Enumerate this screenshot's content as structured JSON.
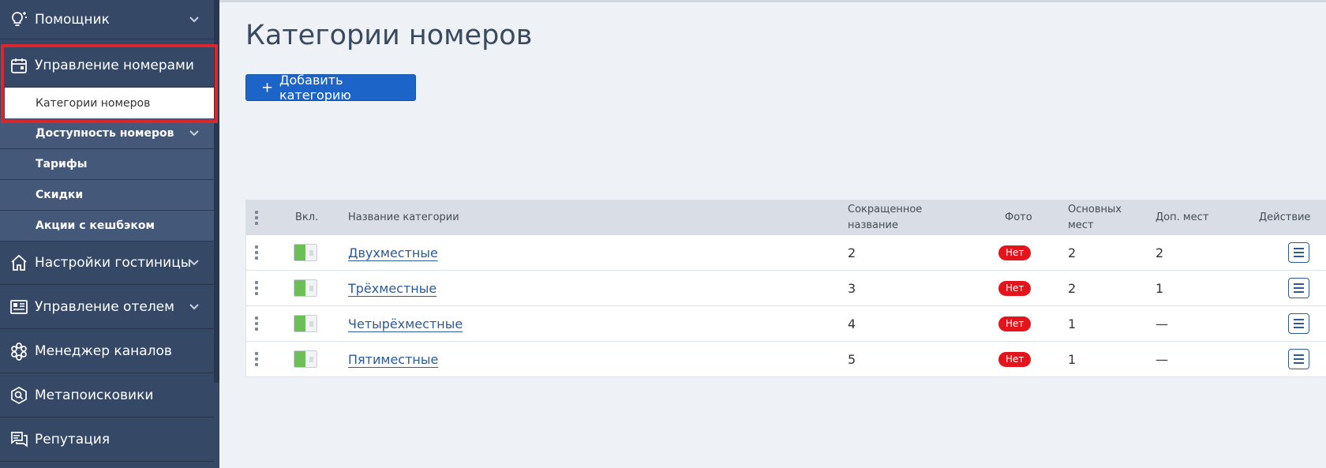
{
  "sidebar": {
    "items": [
      {
        "label": "Помощник"
      },
      {
        "label": "Управление номерами"
      },
      {
        "label": "Настройки гостиницы"
      },
      {
        "label": "Управление отелем"
      },
      {
        "label": "Менеджер каналов"
      },
      {
        "label": "Метапоисковики"
      },
      {
        "label": "Репутация"
      }
    ],
    "subitems": [
      {
        "label": "Категории номеров"
      },
      {
        "label": "Доступность номеров"
      },
      {
        "label": "Тарифы"
      },
      {
        "label": "Скидки"
      },
      {
        "label": "Акции с кешбэком"
      }
    ]
  },
  "page": {
    "title": "Категории номеров",
    "add_button": "Добавить категорию",
    "add_button_icon": "+"
  },
  "table": {
    "headers": {
      "enabled": "Вкл.",
      "name": "Название категории",
      "short_name_1": "Сокращенное",
      "short_name_2": "название",
      "photo": "Фото",
      "main_places_1": "Основных",
      "main_places_2": "мест",
      "extra_places": "Доп. мест",
      "action": "Действие"
    },
    "rows": [
      {
        "name": "Двухместные",
        "short": "2",
        "photo": "Нет",
        "main": "2",
        "extra": "2",
        "enabled": true
      },
      {
        "name": "Трёхместные",
        "short": "3",
        "photo": "Нет",
        "main": "2",
        "extra": "1",
        "enabled": true
      },
      {
        "name": "Четырёхместные",
        "short": "4",
        "photo": "Нет",
        "main": "1",
        "extra": "—",
        "enabled": true
      },
      {
        "name": "Пятиместные",
        "short": "5",
        "photo": "Нет",
        "main": "1",
        "extra": "—",
        "enabled": true
      }
    ]
  },
  "colors": {
    "sidebar_bg": "#354866",
    "primary": "#1c64c7",
    "toggle_on": "#6cbf56",
    "badge_no": "#e3141b",
    "highlight": "#d9272e"
  }
}
